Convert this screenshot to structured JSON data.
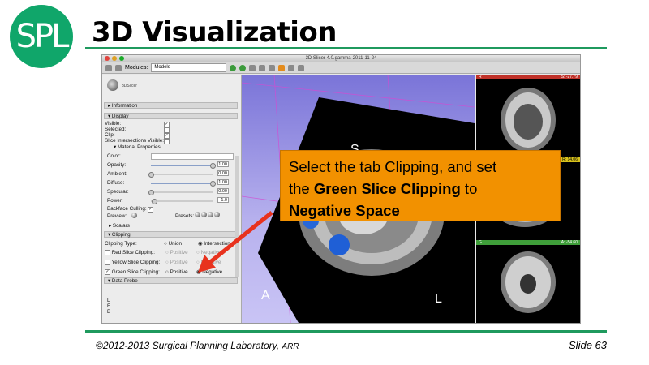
{
  "slide": {
    "logo_text": "SPL",
    "title": "3D Visualization",
    "footer_copyright": "©2012-2013 Surgical Planning Laboratory,",
    "footer_rights": "ARR",
    "slide_number": "Slide 63",
    "colors": {
      "accent": "#1f9a5e",
      "logo": "#10a66a",
      "callout": "#f29100",
      "arrow": "#e8321e"
    }
  },
  "callout": {
    "line1": "Select the tab Clipping, and set",
    "line2_prefix": "the ",
    "line2_bold": "Green Slice Clipping",
    "line2_suffix": " to",
    "line3_bold": "Negative Space"
  },
  "app": {
    "window_title": "3D Slicer 4.0.gamma-2011-11-24",
    "modules_label": "Modules:",
    "module_selected": "Models",
    "brand": "3DSlicer",
    "sections": {
      "information": "Information",
      "display": "Display",
      "material": "Material Properties",
      "scalars": "Scalars",
      "clipping": "Clipping",
      "data_probe": "Data Probe"
    },
    "display": {
      "visible": "Visible:",
      "selected": "Selected:",
      "clip": "Clip:",
      "slice_intersections": "Slice Intersections Visible:"
    },
    "material": {
      "color": "Color:",
      "opacity": {
        "label": "Opacity:",
        "value": "1.00",
        "level": 1.0
      },
      "ambient": {
        "label": "Ambient:",
        "value": "0.00",
        "level": 0.0
      },
      "diffuse": {
        "label": "Diffuse:",
        "value": "1.00",
        "level": 1.0
      },
      "specular": {
        "label": "Specular:",
        "value": "0.00",
        "level": 0.0
      },
      "power": {
        "label": "Power:",
        "value": "1.0",
        "level": 0.05
      },
      "backface": "Backface Culling:",
      "preview": "Preview:",
      "presets": "Presets:"
    },
    "clipping": {
      "type_label": "Clipping Type:",
      "union": "Union",
      "intersection": "Intersection",
      "red": "Red Slice Clipping:",
      "yellow": "Yellow Slice Clipping:",
      "green": "Green Slice Clipping:",
      "positive": "Positive",
      "negative": "Negative"
    },
    "probe_letters": [
      "L",
      "F",
      "B"
    ],
    "view3d_labels": {
      "s": "S",
      "a": "A",
      "l": "L"
    },
    "slice_views": [
      {
        "name": "R",
        "offset": "S: -27.79",
        "color": "#c0322a"
      },
      {
        "name": "Y",
        "offset": "R: 14.06",
        "color": "#d8c21c"
      },
      {
        "name": "G",
        "offset": "A: -54.60",
        "color": "#3f9e3a"
      }
    ]
  }
}
